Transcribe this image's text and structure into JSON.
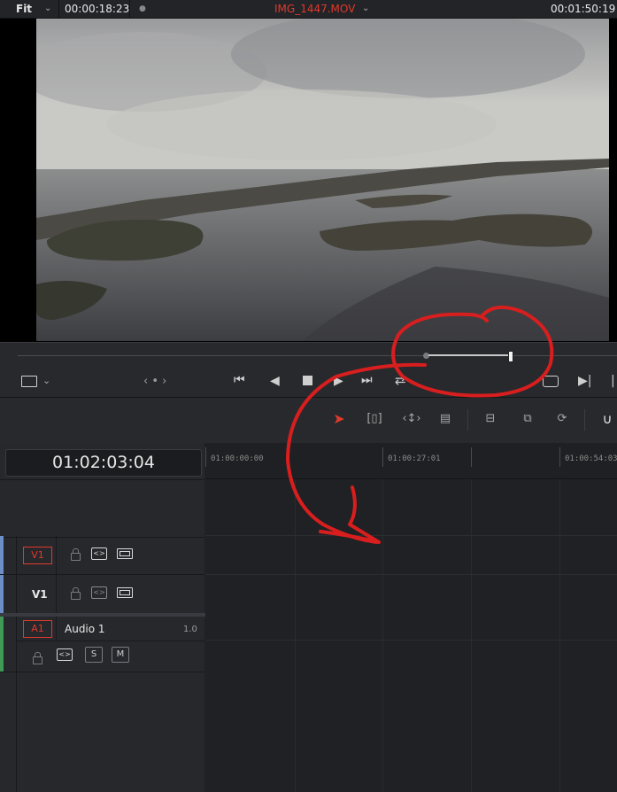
{
  "topbar": {
    "zoom_label": "Fit",
    "source_timecode": "00:00:18:23",
    "clip_name": "IMG_1447.MOV",
    "clip_chevron": "chevron-down-icon",
    "duration_timecode": "00:01:50:19"
  },
  "viewer": {
    "image_description_icon": "video-frame"
  },
  "transport": {
    "view_option_icon": "viewer-mode-icon",
    "jog_label": "‹ • ›",
    "buttons": [
      "jump-to-start",
      "step-back",
      "stop",
      "play",
      "jump-to-end",
      "loop",
      "match-frame",
      "next-edit",
      "prev-edit"
    ]
  },
  "toolbar": {
    "tools": [
      "selection",
      "trim-edit",
      "dynamic-trim",
      "blade",
      "insert-clip",
      "overwrite-clip",
      "replace-clip",
      "snapping"
    ]
  },
  "timeline": {
    "timecode": "01:02:03:04",
    "ruler_labels": [
      "01:00:00:00",
      "01:00:27:01",
      "01:00:54:03"
    ],
    "tracks": [
      {
        "id": "V1",
        "name": "",
        "label_badge": "V1",
        "highlighted": true
      },
      {
        "id": "V1",
        "name": "V1",
        "label_badge": "",
        "highlighted": false
      },
      {
        "id": "A1",
        "name": "Audio 1",
        "label_badge": "A1",
        "level": "1.0",
        "solo_label": "S",
        "mute_label": "M"
      }
    ]
  },
  "annotation": {
    "color": "#d81e1e"
  },
  "colors": {
    "accent_red": "#e0392b",
    "video_track": "#6b8fc6",
    "audio_track": "#3f9a55"
  }
}
